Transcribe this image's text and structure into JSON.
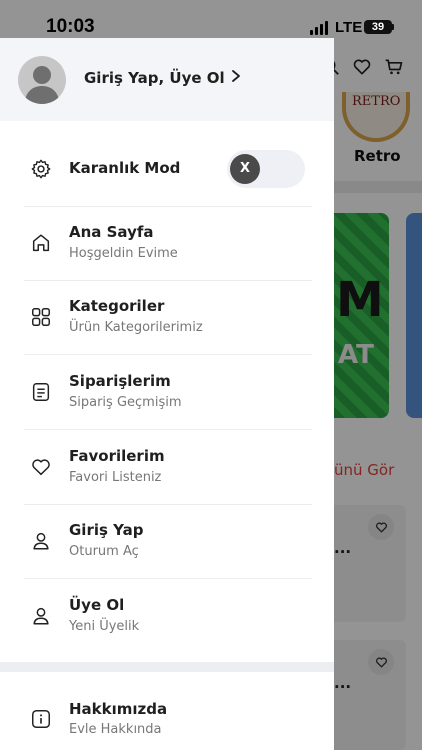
{
  "status_bar": {
    "time": "10:03",
    "network": "LTE",
    "battery": "39"
  },
  "background": {
    "brand_label": "Retro",
    "brand_logo_text": "RETRO",
    "banner_text_big": "M",
    "banner_text_small": "AT",
    "see_all": "ünü Gör",
    "card_dots": "..."
  },
  "drawer": {
    "header": {
      "login_label": "Giriş Yap, Üye Ol"
    },
    "dark_mode": {
      "label": "Karanlık Mod",
      "toggle_text": "X",
      "enabled": false
    },
    "items": [
      {
        "title": "Ana Sayfa",
        "subtitle": "Hoşgeldin Evime",
        "icon": "home-icon"
      },
      {
        "title": "Kategoriler",
        "subtitle": "Ürün Kategorilerimiz",
        "icon": "grid-icon"
      },
      {
        "title": "Siparişlerim",
        "subtitle": "Sipariş Geçmişim",
        "icon": "orders-icon"
      },
      {
        "title": "Favorilerim",
        "subtitle": "Favori Listeniz",
        "icon": "heart-icon"
      },
      {
        "title": "Giriş Yap",
        "subtitle": "Oturum Aç",
        "icon": "user-icon"
      },
      {
        "title": "Üye Ol",
        "subtitle": "Yeni Üyelik",
        "icon": "user-icon"
      }
    ],
    "about": {
      "title": "Hakkımızda",
      "subtitle": "Evle Hakkında",
      "icon": "info-icon"
    }
  },
  "colors": {
    "accent_red": "#e0433a",
    "text_dark": "#1f1f1f",
    "text_muted": "#777777",
    "header_bg": "#f4f5f8"
  }
}
